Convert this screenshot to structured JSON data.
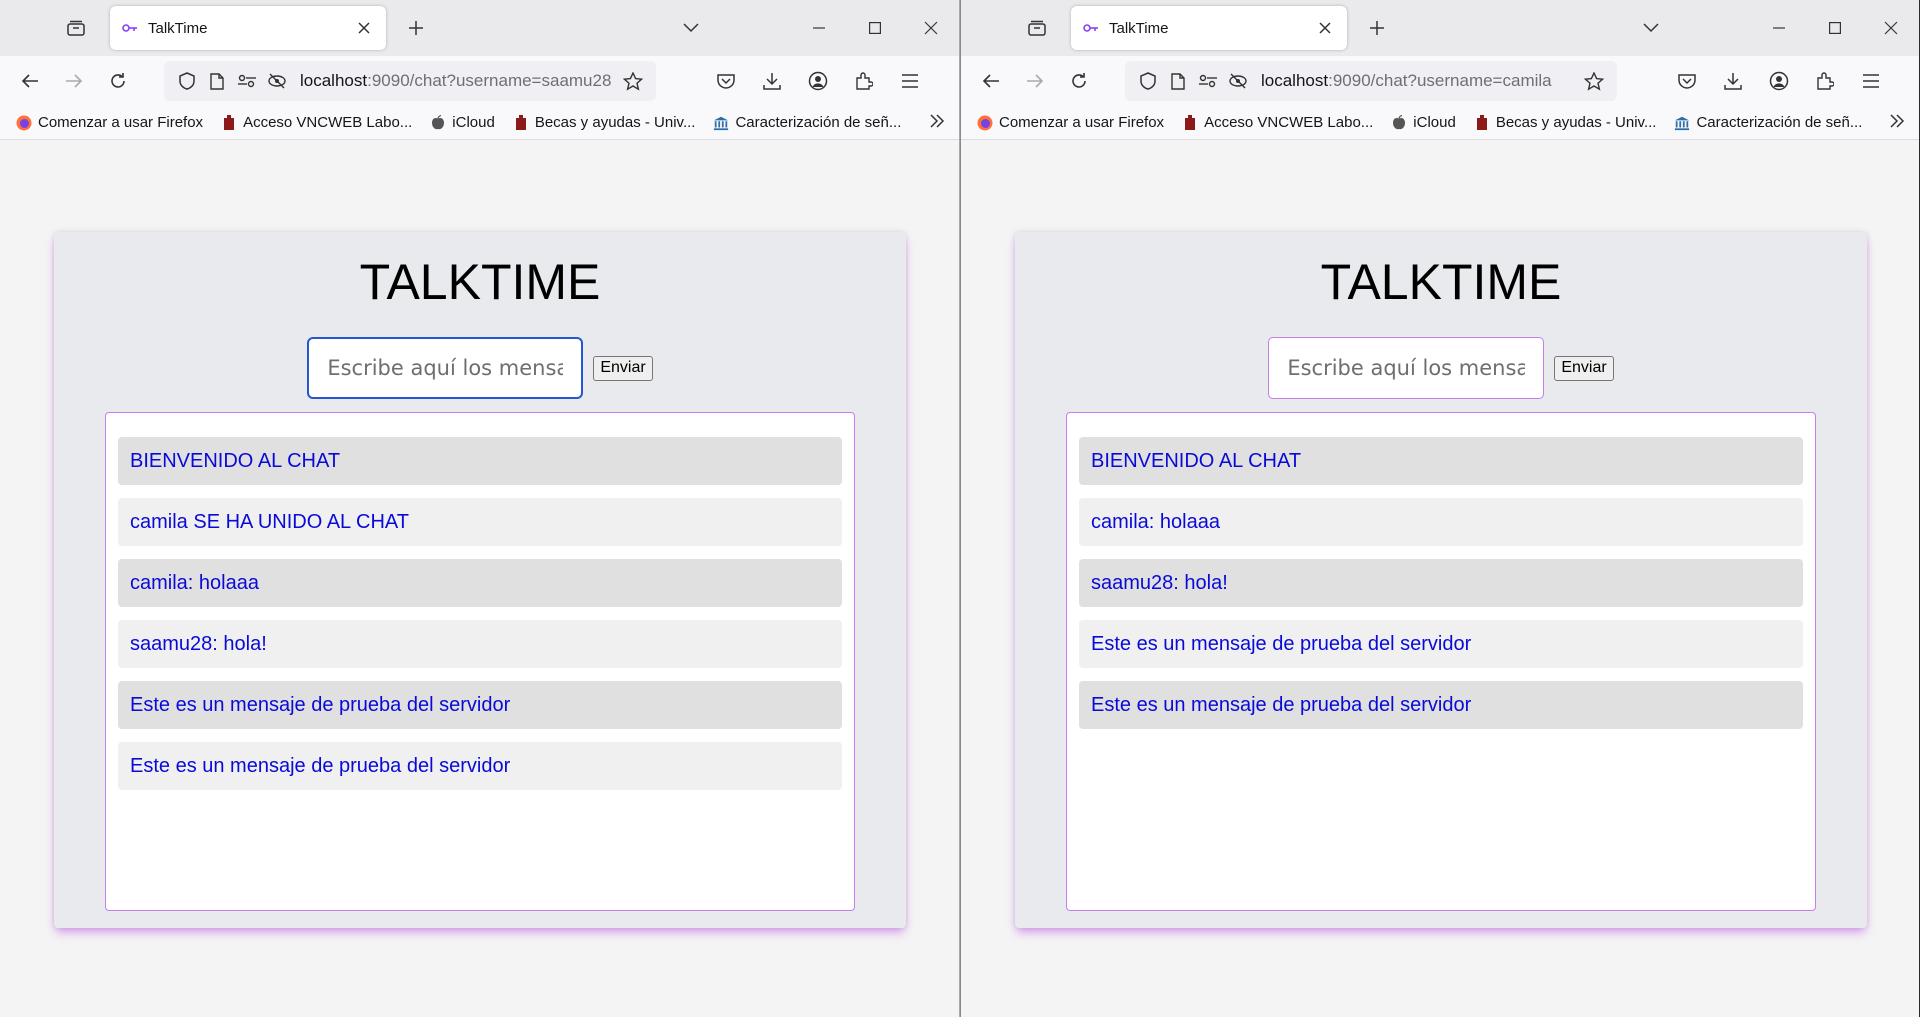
{
  "windows": [
    {
      "tab_title": "TalkTime",
      "url_host": "localhost",
      "url_rest": ":9090/chat?username=saamu28",
      "bookmarks": [
        "Comenzar a usar Firefox",
        "Acceso VNCWEB Labo...",
        "iCloud",
        "Becas y ayudas - Univ...",
        "Caracterización de señ..."
      ],
      "app_title": "TALKTIME",
      "input_placeholder": "Escribe aquí los mensajes...",
      "send_label": "Enviar",
      "messages": [
        "BIENVENIDO AL CHAT",
        "camila SE HA UNIDO AL CHAT",
        "camila: holaaa",
        "saamu28: hola!",
        "Este es un mensaje de prueba del servidor",
        "Este es un mensaje de prueba del servidor"
      ]
    },
    {
      "tab_title": "TalkTime",
      "url_host": "localhost",
      "url_rest": ":9090/chat?username=camila",
      "bookmarks": [
        "Comenzar a usar Firefox",
        "Acceso VNCWEB Labo...",
        "iCloud",
        "Becas y ayudas - Univ...",
        "Caracterización de señ..."
      ],
      "app_title": "TALKTIME",
      "input_placeholder": "Escribe aquí los mensajes...",
      "send_label": "Enviar",
      "messages": [
        "BIENVENIDO AL CHAT",
        "camila: holaaa",
        "saamu28: hola!",
        "Este es un mensaje de prueba del servidor",
        "Este es un mensaje de prueba del servidor"
      ]
    }
  ],
  "colors": {
    "message_text": "#0a0ad8",
    "accent_border": "#c77dec",
    "focus_border": "#2556d6"
  }
}
